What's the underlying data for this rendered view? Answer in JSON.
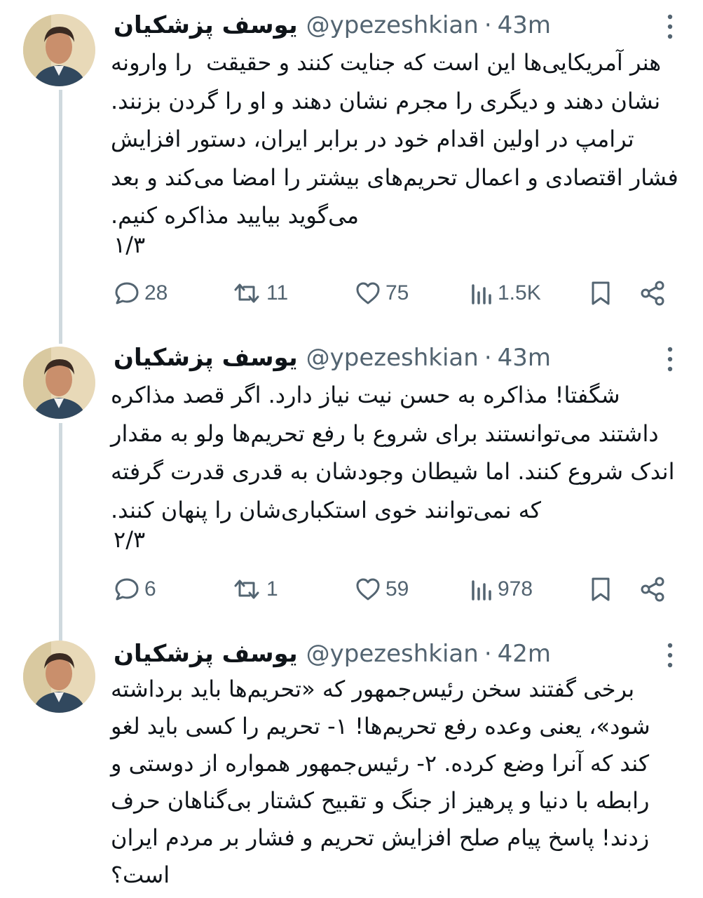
{
  "colors": {
    "text": "#0f1419",
    "secondary": "#536471",
    "thread_line": "#cfd9de"
  },
  "icons": {
    "reply": "speech-bubble-icon",
    "retweet": "retweet-arrows-icon",
    "like": "heart-icon",
    "views": "bar-chart-icon",
    "bookmark": "bookmark-icon",
    "share": "share-icon",
    "more": "vertical-ellipsis-icon"
  },
  "tweets": [
    {
      "display_name": "یوسف پزشکیان",
      "handle": "@ypezeshkian",
      "separator": "·",
      "time": "43m",
      "text": "هنر آمریکایی‌ها این است که جنایت کنند و حقیقت  را وارونه نشان دهند و دیگری را مجرم نشان دهند و او را گردن بزنند. ترامپ در اولین اقدام خود در برابر ایران، دستور افزایش فشار اقتصادی و اعمال تحریم‌های بیشتر را امضا می‌کند و بعد می‌گوید بیایید مذاکره کنیم.",
      "counter": "۱/۳",
      "replies": "28",
      "retweets": "11",
      "likes": "75",
      "views": "1.5K"
    },
    {
      "display_name": "یوسف پزشکیان",
      "handle": "@ypezeshkian",
      "separator": "·",
      "time": "43m",
      "text": "شگفتا! مذاکره به حسن نیت نیاز دارد. اگر قصد مذاکره داشتند می‌توانستند برای شروع با رفع تحریم‌ها ولو به مقدار اندک شروع کنند. اما شیطان وجودشان به قدری قدرت گرفته که نمی‌توانند خوی استکباری‌شان را پنهان کنند.",
      "counter": "۲/۳",
      "replies": "6",
      "retweets": "1",
      "likes": "59",
      "views": "978"
    },
    {
      "display_name": "یوسف پزشکیان",
      "handle": "@ypezeshkian",
      "separator": "·",
      "time": "42m",
      "text": "برخی گفتند سخن رئیس‌جمهور که «تحریم‌ها باید برداشته شود»، یعنی وعده رفع تحریم‌ها! ۱- تحریم را کسی باید لغو کند که آنرا وضع کرده. ۲- رئیس‌جمهور همواره از دوستی و رابطه با دنیا و پرهیز از جنگ و تقبیح کشتار بی‌گناهان حرف زدند! پاسخ پیام صلح افزایش تحریم و فشار بر مردم ایران است؟"
    }
  ]
}
